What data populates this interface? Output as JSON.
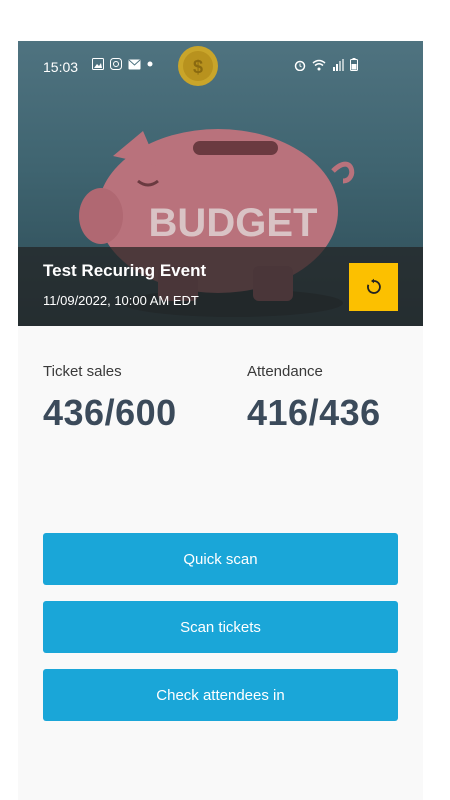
{
  "status_bar": {
    "time": "15:03",
    "left_icons": [
      "image-icon",
      "instagram-icon",
      "mail-icon",
      "dot-icon"
    ],
    "right_icons": [
      "alarm-icon",
      "wifi-icon",
      "signal-icon",
      "battery-icon"
    ]
  },
  "hero": {
    "image_text": "BUDGET",
    "event_title": "Test Recuring Event",
    "event_date": "11/09/2022, 10:00 AM EDT",
    "refresh_icon": "refresh-icon",
    "refresh_color": "#fcc000"
  },
  "stats": {
    "ticket_sales_label": "Ticket sales",
    "ticket_sales_value": "436/600",
    "attendance_label": "Attendance",
    "attendance_value": "416/436"
  },
  "actions": {
    "quick_scan": "Quick scan",
    "scan_tickets": "Scan tickets",
    "check_in": "Check attendees in",
    "button_color": "#1aa6d8"
  }
}
